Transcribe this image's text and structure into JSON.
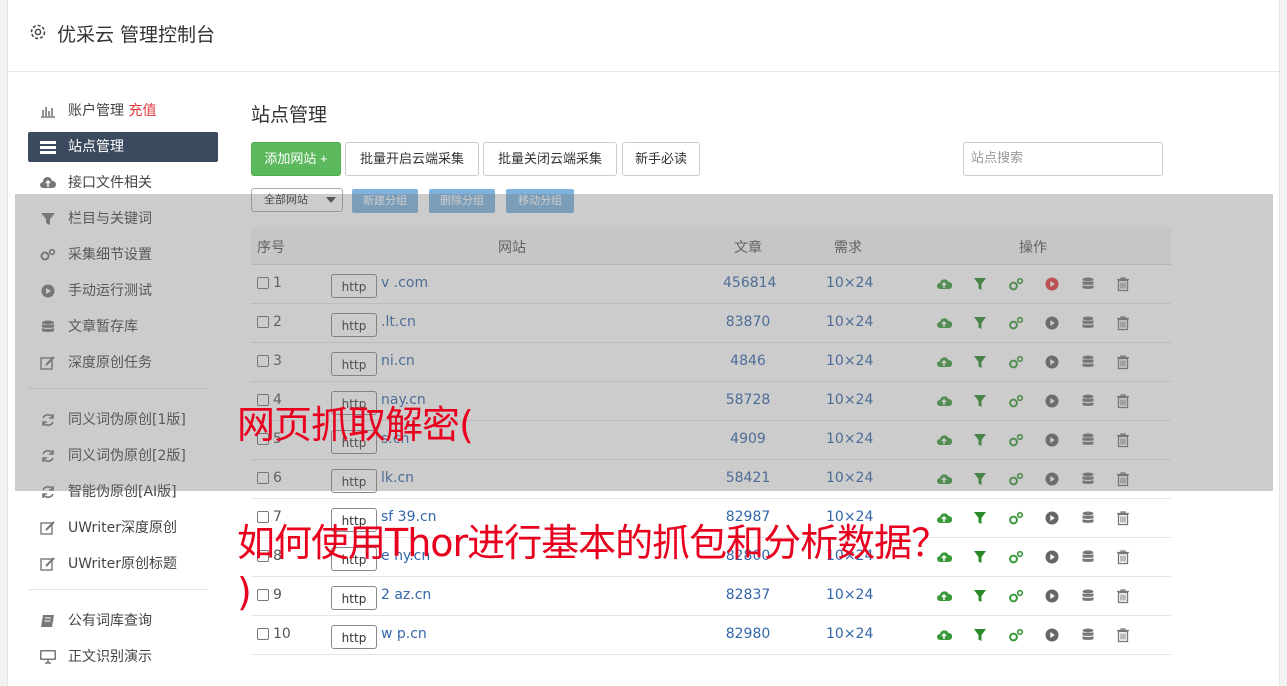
{
  "header": {
    "title": "优采云 管理控制台"
  },
  "sidebar": {
    "items": [
      {
        "label": "账户管理",
        "extra": "充值",
        "icon": "bar-chart-icon"
      },
      {
        "label": "站点管理",
        "icon": "server-list-icon",
        "active": true
      },
      {
        "label": "接口文件相关",
        "icon": "cloud-upload-icon"
      },
      {
        "label": "栏目与关键词",
        "icon": "filter-icon"
      },
      {
        "label": "采集细节设置",
        "icon": "gears-icon"
      },
      {
        "label": "手动运行测试",
        "icon": "play-circle-icon"
      },
      {
        "label": "文章暂存库",
        "icon": "database-icon"
      },
      {
        "label": "深度原创任务",
        "icon": "edit-icon"
      }
    ],
    "group2": [
      {
        "label": "同义词伪原创[1版]",
        "icon": "refresh-icon"
      },
      {
        "label": "同义词伪原创[2版]",
        "icon": "refresh-icon"
      },
      {
        "label": "智能伪原创[AI版]",
        "icon": "refresh-icon"
      },
      {
        "label": "UWriter深度原创",
        "icon": "edit-icon"
      },
      {
        "label": "UWriter原创标题",
        "icon": "edit-icon"
      }
    ],
    "group3": [
      {
        "label": "公有词库查询",
        "icon": "book-icon"
      },
      {
        "label": "正文识别演示",
        "icon": "monitor-icon"
      }
    ]
  },
  "main": {
    "title": "站点管理",
    "add_label": "添加网站 +",
    "batch_on": "批量开启云端采集",
    "batch_off": "批量关闭云端采集",
    "guide": "新手必读",
    "search_placeholder": "站点搜索",
    "group_select": "全部网站",
    "new_group": "新建分组",
    "delete_group": "删除分组",
    "move_group": "移动分组"
  },
  "table": {
    "headers": {
      "no": "序号",
      "site": "网站",
      "articles": "文章",
      "demand": "需求",
      "ops": "操作"
    },
    "http_label": "http",
    "rows": [
      {
        "no": "1",
        "site": "v           .com",
        "articles": "456814",
        "demand": "10×24",
        "play_active": true
      },
      {
        "no": "2",
        "site": "      .lt.cn",
        "articles": "83870",
        "demand": "10×24"
      },
      {
        "no": "3",
        "site": "      ni.cn",
        "articles": "4846",
        "demand": "10×24"
      },
      {
        "no": "4",
        "site": "        nay.cn",
        "articles": "58728",
        "demand": "10×24"
      },
      {
        "no": "5",
        "site": "      s.cn",
        "articles": "4909",
        "demand": "10×24"
      },
      {
        "no": "6",
        "site": "      lk.cn",
        "articles": "58421",
        "demand": "10×24"
      },
      {
        "no": "7",
        "site": "sf   39.cn",
        "articles": "82987",
        "demand": "10×24"
      },
      {
        "no": "8",
        "site": "e      ny.cn",
        "articles": "82800",
        "demand": "10×24"
      },
      {
        "no": "9",
        "site": "2      az.cn",
        "articles": "82837",
        "demand": "10×24"
      },
      {
        "no": "10",
        "site": "w      p.cn",
        "articles": "82980",
        "demand": "10×24"
      }
    ]
  },
  "overlay_caption": {
    "line1": "网页抓取解密(",
    "line2": "如何使用Thor进行基本的抓包和分析数据？",
    "line3": ")"
  },
  "colors": {
    "accent_green": "#5cb85c",
    "nav_active": "#3b4a5e",
    "link_blue": "#3366aa",
    "caption_red": "#e8001e"
  }
}
